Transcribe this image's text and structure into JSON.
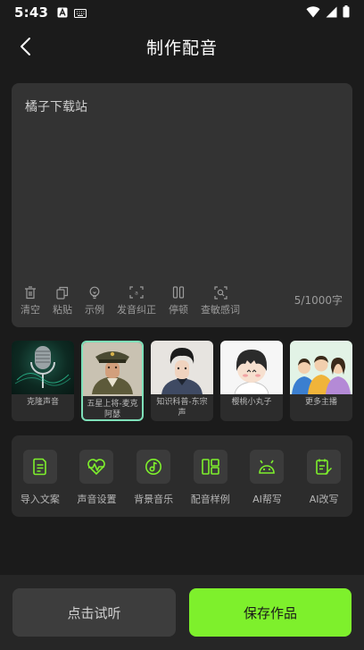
{
  "status_bar": {
    "time": "5:43"
  },
  "header": {
    "title": "制作配音"
  },
  "editor": {
    "text": "橘子下载站",
    "counter": "5/1000字",
    "tools": [
      {
        "label": "清空",
        "icon": "trash-icon"
      },
      {
        "label": "粘贴",
        "icon": "paste-icon"
      },
      {
        "label": "示例",
        "icon": "bulb-icon"
      },
      {
        "label": "发音纠正",
        "icon": "pronunciation-icon"
      },
      {
        "label": "停顿",
        "icon": "pause-icon"
      },
      {
        "label": "查敏感词",
        "icon": "scan-icon"
      }
    ]
  },
  "voices": [
    {
      "label": "克隆声音",
      "selected": false
    },
    {
      "label": "五星上将-麦克阿瑟",
      "selected": true
    },
    {
      "label": "知识科普-东宗声",
      "selected": false
    },
    {
      "label": "樱桃小丸子",
      "selected": false
    },
    {
      "label": "更多主播",
      "selected": false
    }
  ],
  "actions": [
    {
      "label": "导入文案",
      "icon": "document-icon"
    },
    {
      "label": "声音设置",
      "icon": "heartbeat-icon"
    },
    {
      "label": "背景音乐",
      "icon": "music-icon"
    },
    {
      "label": "配音样例",
      "icon": "layout-icon"
    },
    {
      "label": "AI帮写",
      "icon": "robot-icon"
    },
    {
      "label": "AI改写",
      "icon": "rewrite-icon"
    }
  ],
  "bottom": {
    "listen_label": "点击试听",
    "save_label": "保存作品"
  },
  "colors": {
    "accent_green": "#7ef02c",
    "selected_border": "#7ee0b9",
    "background": "#1b1b1b"
  }
}
